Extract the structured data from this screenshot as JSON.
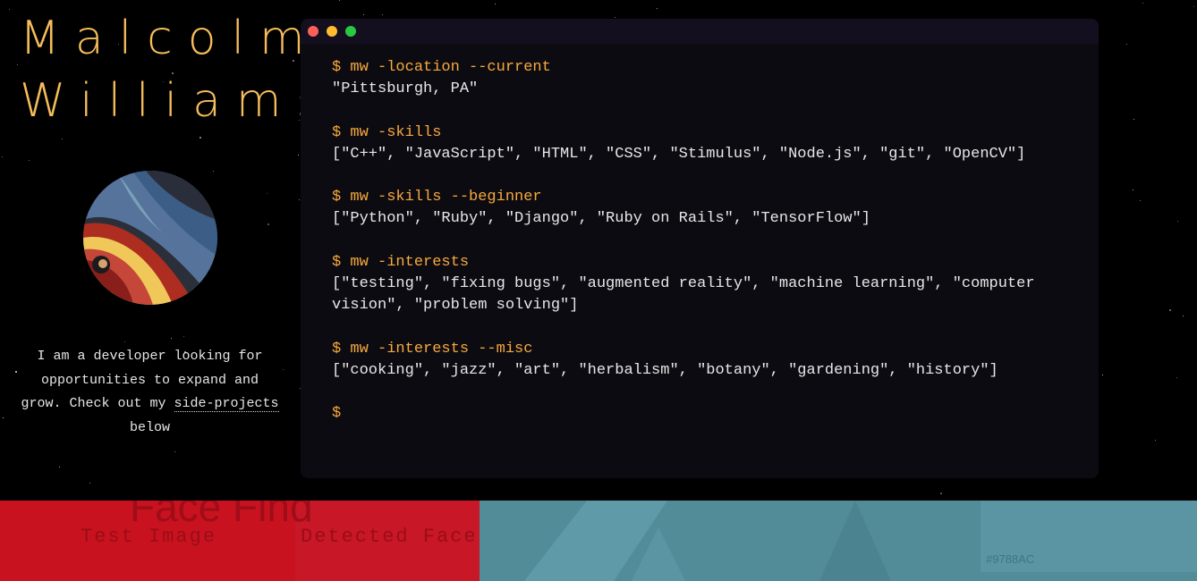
{
  "profile": {
    "first_name": "Malcolm",
    "last_name": "Williams",
    "bio_text": "I am a developer looking for opportunities to expand and grow. Check out my ",
    "bio_link": "side-projects",
    "bio_after": " below"
  },
  "terminal": {
    "blocks": [
      {
        "command": "$ mw -location --current",
        "output": "\"Pittsburgh, PA\""
      },
      {
        "command": "$ mw -skills",
        "output": "[\"C++\", \"JavaScript\", \"HTML\", \"CSS\", \"Stimulus\", \"Node.js\", \"git\", \"OpenCV\"]"
      },
      {
        "command": "$ mw -skills --beginner",
        "output": "[\"Python\", \"Ruby\", \"Django\", \"Ruby on Rails\", \"TensorFlow\"]"
      },
      {
        "command": "$ mw -interests",
        "output": "[\"testing\", \"fixing bugs\", \"augmented reality\", \"machine learning\", \"computer vision\", \"problem solving\"]"
      },
      {
        "command": "$ mw -interests --misc",
        "output": "[\"cooking\", \"jazz\", \"art\", \"herbalism\", \"botany\", \"gardening\", \"history\"]"
      }
    ],
    "prompt": "$"
  },
  "projects": {
    "face_find": {
      "title": "Face Find",
      "label_test": "Test Image",
      "label_detected": "Detected Face"
    },
    "color_tool": {
      "hex": "#9788AC"
    }
  },
  "colors": {
    "accent": "#f6bd5b",
    "prompt": "#f6a93c",
    "terminal_bg": "#0d0b12",
    "project_red": "#c8121f",
    "project_teal": "#528c99"
  }
}
